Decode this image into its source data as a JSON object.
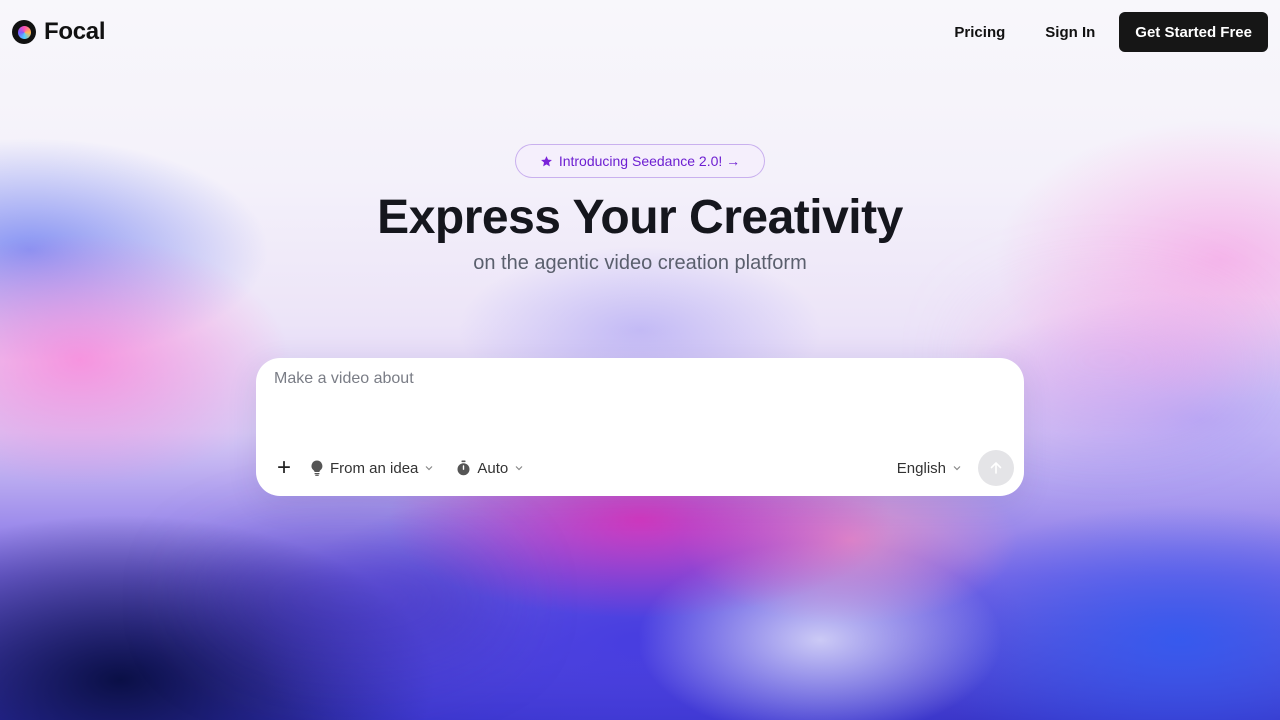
{
  "brand": {
    "name": "Focal",
    "logo_icon": "focal-logo-icon"
  },
  "nav": {
    "pricing": "Pricing",
    "sign_in": "Sign In",
    "cta": "Get Started Free"
  },
  "hero": {
    "announcement": "Introducing Seedance 2.0! →",
    "announcement_icon": "star-icon",
    "title": "Express Your Creativity",
    "subtitle": "on the agentic video creation platform"
  },
  "composer": {
    "placeholder": "Make a video about",
    "value": "",
    "add_icon": "plus-icon",
    "mode": {
      "label": "From an idea",
      "icon": "lightbulb-icon"
    },
    "duration": {
      "label": "Auto",
      "icon": "stopwatch-icon"
    },
    "language": {
      "label": "English"
    },
    "send_icon": "arrow-up-icon"
  },
  "colors": {
    "accent": "#6d1fd1",
    "cta_bg": "#161616",
    "text": "#15161d"
  }
}
